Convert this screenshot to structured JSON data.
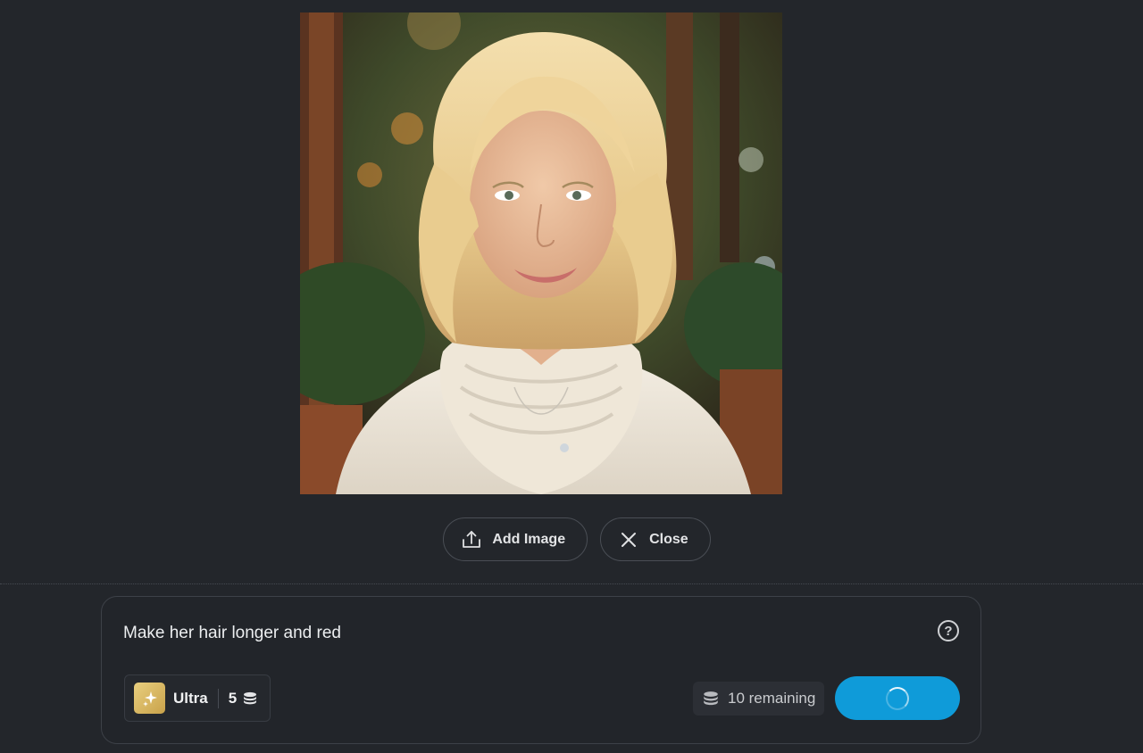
{
  "image_actions": {
    "add_image_label": "Add Image",
    "close_label": "Close"
  },
  "prompt": {
    "text": "Make her hair longer and red",
    "help_glyph": "?"
  },
  "model": {
    "name": "Ultra",
    "cost": "5",
    "badge_icon": "sparkle-icon",
    "cost_icon": "coin-stack-icon"
  },
  "credits": {
    "remaining_label": "10 remaining",
    "icon": "coin-stack-icon"
  },
  "generate": {
    "state": "loading"
  },
  "colors": {
    "background": "#23262b",
    "accent": "#0f9bd9",
    "badge_gold": "#d8b660"
  }
}
